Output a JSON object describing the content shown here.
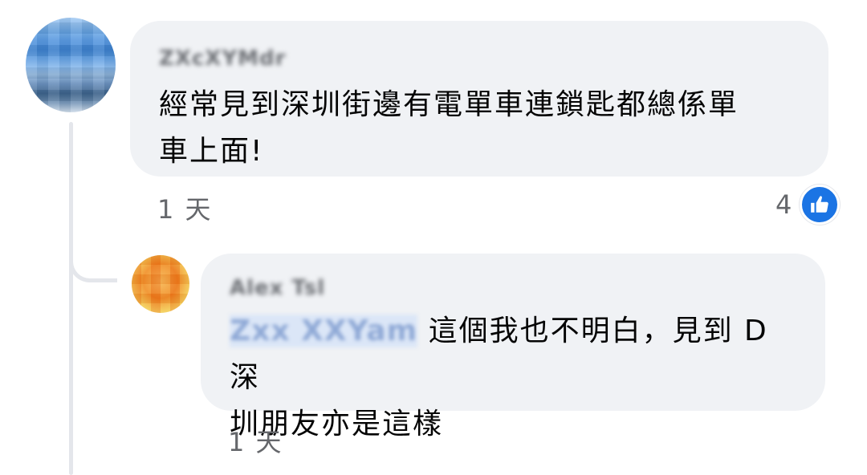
{
  "comments": {
    "main": {
      "author": "ZXcXYMdr",
      "text_line1": "經常見到深圳街邊有電單車連鎖匙都總係單",
      "text_line2": "車上面!",
      "time": "1 天",
      "reaction_count": "4",
      "reaction_icon": "like-icon"
    },
    "reply": {
      "author": "Alex Tsl",
      "mention": "Zxx XXYam",
      "text_line1": " 這個我也不明白，見到 D 深",
      "text_line2": "圳朋友亦是這樣",
      "time": "1 天"
    }
  },
  "colors": {
    "bubble": "#f0f2f5",
    "meta_text": "#65676b",
    "like_blue": "#1b74e4",
    "thread_line": "#e4e6eb"
  }
}
